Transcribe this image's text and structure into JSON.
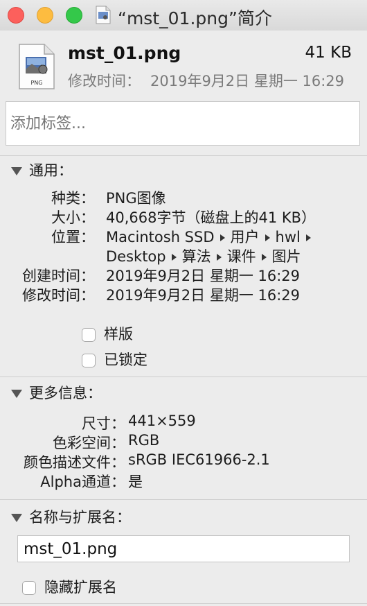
{
  "window": {
    "title": "“mst_01.png”简介"
  },
  "header": {
    "file_name": "mst_01.png",
    "file_size": "41 KB",
    "modified_label": "修改时间：",
    "modified_value": "2019年9月2日 星期一 16:29"
  },
  "tags": {
    "placeholder": "添加标签..."
  },
  "general": {
    "title": "通用：",
    "kind_label": "种类：",
    "kind_value": "PNG图像",
    "size_label": "大小：",
    "size_value": "40,668字节（磁盘上的41 KB）",
    "where_label": "位置：",
    "where_path": [
      "Macintosh SSD",
      "用户",
      "hwl",
      "Desktop",
      "算法",
      "课件",
      "图片"
    ],
    "created_label": "创建时间：",
    "created_value": "2019年9月2日 星期一 16:29",
    "modified_label": "修改时间：",
    "modified_value": "2019年9月2日 星期一 16:29",
    "stationery_label": "样版",
    "locked_label": "已锁定"
  },
  "more_info": {
    "title": "更多信息：",
    "dimensions_label": "尺寸：",
    "dimensions_value": "441×559",
    "color_space_label": "色彩空间：",
    "color_space_value": "RGB",
    "color_profile_label": "颜色描述文件：",
    "color_profile_value": "sRGB IEC61966-2.1",
    "alpha_label": "Alpha通道：",
    "alpha_value": "是"
  },
  "name_ext": {
    "title": "名称与扩展名：",
    "name_value": "mst_01.png",
    "hide_ext_label": "隐藏扩展名"
  },
  "icons": {
    "file_icon_badge": "PNG"
  },
  "colors": {
    "close": "#fc605c",
    "minimize": "#fdbc40",
    "maximize": "#34c84a"
  }
}
